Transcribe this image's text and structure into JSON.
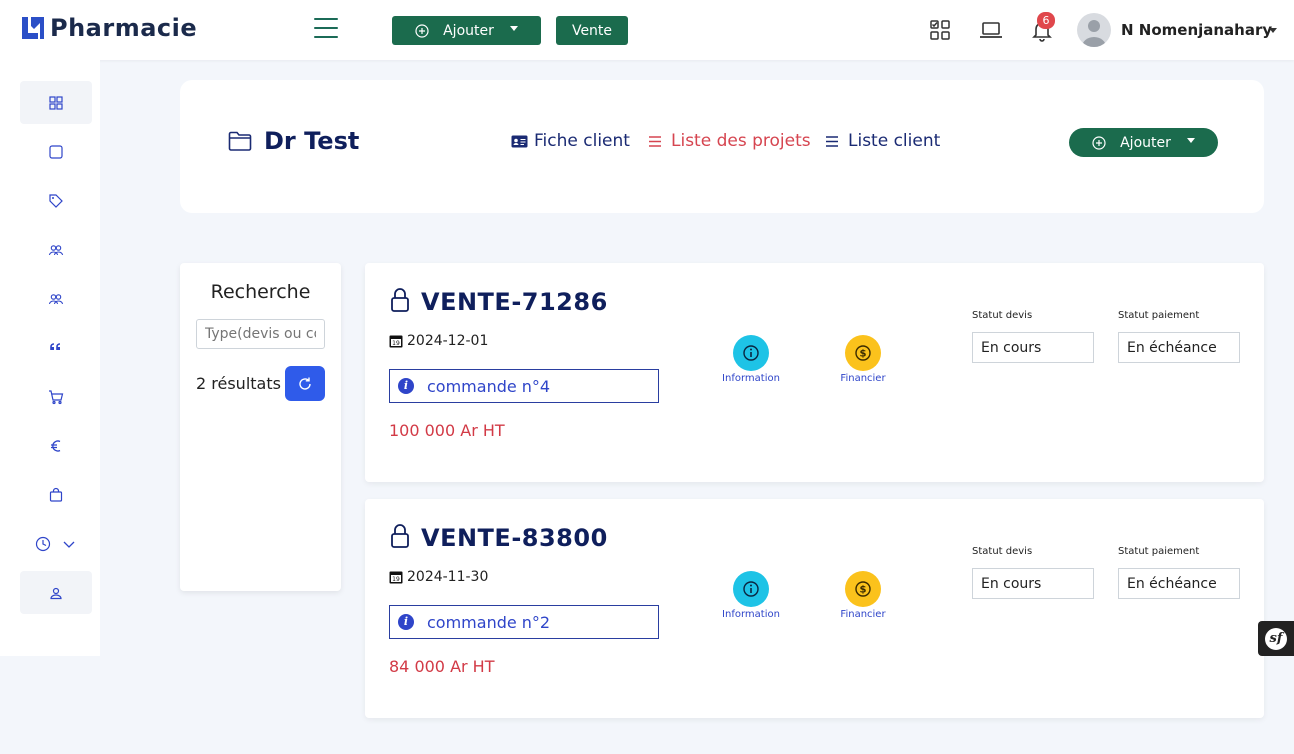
{
  "app": {
    "brand": "Pharmacie"
  },
  "topbar": {
    "add_label": "Ajouter",
    "sale_label": "Vente",
    "notification_count": "6",
    "user_name": "N Nomenjanahary"
  },
  "sidebar": {
    "items": [
      {
        "icon": "grid-icon",
        "active": true
      },
      {
        "icon": "square-icon"
      },
      {
        "icon": "tag-icon"
      },
      {
        "icon": "users-icon"
      },
      {
        "icon": "team-icon"
      },
      {
        "icon": "quote-icon"
      },
      {
        "icon": "cart-icon"
      },
      {
        "icon": "euro-icon"
      },
      {
        "icon": "bag-icon"
      },
      {
        "icon": "clock-icon",
        "expandable": true
      },
      {
        "icon": "user-icon",
        "active": true
      }
    ]
  },
  "client": {
    "name": "Dr Test",
    "tabs": [
      {
        "label": "Fiche client"
      },
      {
        "label": "Liste des projets"
      },
      {
        "label": "Liste client"
      }
    ],
    "add_label": "Ajouter"
  },
  "search": {
    "title": "Recherche",
    "placeholder": "Type(devis ou commande)",
    "result_count": "2 résultats"
  },
  "sales": [
    {
      "ref": "VENTE-71286",
      "date": "2024-12-01",
      "order": "commande n°4",
      "amount": "100 000 Ar HT",
      "info_label": "Information",
      "finance_label": "Financier",
      "quote_status_label": "Statut devis",
      "quote_status": "En cours",
      "payment_status_label": "Statut paiement",
      "payment_status": "En échéance"
    },
    {
      "ref": "VENTE-83800",
      "date": "2024-11-30",
      "order": "commande n°2",
      "amount": "84 000 Ar HT",
      "info_label": "Information",
      "finance_label": "Financier",
      "quote_status_label": "Statut devis",
      "quote_status": "En cours",
      "payment_status_label": "Statut paiement",
      "payment_status": "En échéance"
    }
  ],
  "colors": {
    "primary_green": "#1b6b4d",
    "navy": "#0f1f5c",
    "accent_red": "#d64550",
    "link_blue": "#2f45c9"
  }
}
